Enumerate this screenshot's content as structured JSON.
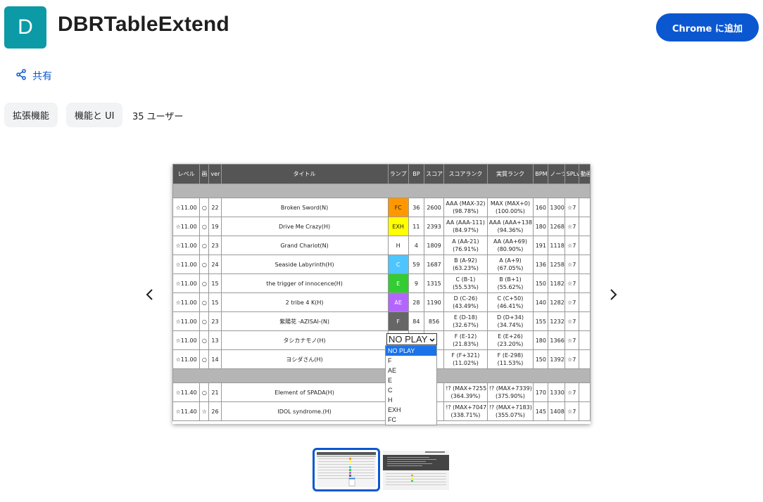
{
  "header": {
    "icon_letter": "D",
    "title": "DBRTableExtend",
    "add_button": "Chrome に追加"
  },
  "share": {
    "label": "共有"
  },
  "chips": {
    "category": "拡張機能",
    "subcategory": "機能と UI"
  },
  "users": "35 ユーザー",
  "table": {
    "headers": [
      "レベル",
      "画",
      "ver",
      "タイトル",
      "ランプ",
      "BP",
      "スコア",
      "スコアランク",
      "実質ランク",
      "BPM",
      "ノーツ数",
      "SPLv",
      "動画"
    ],
    "rows": [
      {
        "level": "☆11.00",
        "mark": "○",
        "ver": "22",
        "title": "Broken Sword(N)",
        "lamp": "FC",
        "bp": "36",
        "score": "2600",
        "rank1": "AAA (MAX-32)",
        "rank1b": "(98.78%)",
        "rank2": "MAX (MAX+0)",
        "rank2b": "(100.00%)",
        "bpm": "160",
        "notes": "1300",
        "splv": "☆7"
      },
      {
        "level": "☆11.00",
        "mark": "○",
        "ver": "19",
        "title": "Drive Me Crazy(H)",
        "lamp": "EXH",
        "bp": "11",
        "score": "2393",
        "rank1": "AA (AAA-111)",
        "rank1b": "(84.97%)",
        "rank2": "AAA (AAA+138)",
        "rank2b": "(94.36%)",
        "bpm": "180",
        "notes": "1268",
        "splv": "☆7"
      },
      {
        "level": "☆11.00",
        "mark": "○",
        "ver": "23",
        "title": "Grand Chariot(N)",
        "lamp": "H",
        "bp": "4",
        "score": "1809",
        "rank1": "A (AA-21)",
        "rank1b": "(76.91%)",
        "rank2": "AA (AA+69)",
        "rank2b": "(80.90%)",
        "bpm": "191",
        "notes": "1118",
        "splv": "☆7"
      },
      {
        "level": "☆11.00",
        "mark": "○",
        "ver": "24",
        "title": "Seaside Labyrinth(H)",
        "lamp": "C",
        "bp": "59",
        "score": "1687",
        "rank1": "B (A-92)",
        "rank1b": "(63.23%)",
        "rank2": "A (A+9)",
        "rank2b": "(67.05%)",
        "bpm": "136",
        "notes": "1258",
        "splv": "☆7"
      },
      {
        "level": "☆11.00",
        "mark": "○",
        "ver": "15",
        "title": "the trigger of innocence(H)",
        "lamp": "E",
        "bp": "9",
        "score": "1315",
        "rank1": "C (B-1)",
        "rank1b": "(55.53%)",
        "rank2": "B (B+1)",
        "rank2b": "(55.62%)",
        "bpm": "150",
        "notes": "1182",
        "splv": "☆7"
      },
      {
        "level": "☆11.00",
        "mark": "○",
        "ver": "15",
        "title": "2 tribe 4 K(H)",
        "lamp": "AE",
        "bp": "28",
        "score": "1190",
        "rank1": "D (C-26)",
        "rank1b": "(43.49%)",
        "rank2": "C (C+50)",
        "rank2b": "(46.41%)",
        "bpm": "140",
        "notes": "1282",
        "splv": "☆7"
      },
      {
        "level": "☆11.00",
        "mark": "○",
        "ver": "23",
        "title": "紫陽花 -AZISAI-(N)",
        "lamp": "F",
        "bp": "84",
        "score": "856",
        "rank1": "E (D-18)",
        "rank1b": "(32.67%)",
        "rank2": "D (D+34)",
        "rank2b": "(34.74%)",
        "bpm": "155",
        "notes": "1232",
        "splv": "☆7"
      },
      {
        "level": "☆11.00",
        "mark": "○",
        "ver": "13",
        "title": "タシカナモノ(H)",
        "lamp": "",
        "bp": "",
        "score": "",
        "rank1": "F (E-12)",
        "rank1b": "(21.83%)",
        "rank2": "E (E+26)",
        "rank2b": "(23.20%)",
        "bpm": "180",
        "notes": "1366",
        "splv": "☆7"
      },
      {
        "level": "☆11.00",
        "mark": "○",
        "ver": "14",
        "title": "ヨシダさん(H)",
        "lamp": "",
        "bp": "",
        "score": "",
        "rank1": "F (F+321)",
        "rank1b": "(11.02%)",
        "rank2": "F (E-298)",
        "rank2b": "(11.53%)",
        "bpm": "150",
        "notes": "1392",
        "splv": "☆7"
      },
      {
        "level": "☆11.40",
        "mark": "○",
        "ver": "21",
        "title": "Element of SPADA(H)",
        "lamp": "",
        "bp": "",
        "score": "9",
        "rank1": "!? (MAX+7255)",
        "rank1b": "(364.39%)",
        "rank2": "!? (MAX+7339)",
        "rank2b": "(375.90%)",
        "bpm": "170",
        "notes": "1330",
        "splv": "☆7"
      },
      {
        "level": "☆11.40",
        "mark": "☆",
        "ver": "26",
        "title": "IDOL syndrome.(H)",
        "lamp": "",
        "bp": "",
        "score": "9",
        "rank1": "!? (MAX+7047)",
        "rank1b": "(338.71%)",
        "rank2": "!? (MAX+7183)",
        "rank2b": "(355.07%)",
        "bpm": "145",
        "notes": "1408",
        "splv": "☆7"
      }
    ]
  },
  "lamp_select": {
    "value": "NO PLAY",
    "options": [
      "NO PLAY",
      "F",
      "AE",
      "E",
      "C",
      "H",
      "EXH",
      "FC"
    ]
  },
  "colors": {
    "accent": "#0b57d0",
    "icon_bg": "#0b9aa6"
  }
}
